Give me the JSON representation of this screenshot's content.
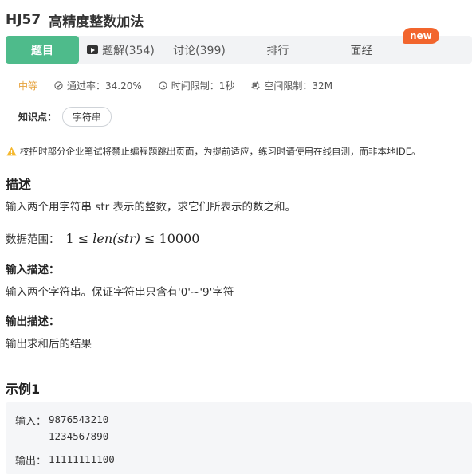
{
  "problem": {
    "id": "HJ57",
    "name": "高精度整数加法"
  },
  "tabs": {
    "question": "题目",
    "solution": "题解(354)",
    "discuss": "讨论(399)",
    "rank": "排行",
    "interview": "面经",
    "new_badge": "new"
  },
  "meta": {
    "difficulty": "中等",
    "pass_rate": "通过率：34.20%",
    "time_limit": "时间限制：1秒",
    "space_limit": "空间限制：32M"
  },
  "knowledge": {
    "label": "知识点：",
    "tags": [
      "字符串"
    ]
  },
  "notice": "校招时部分企业笔试将禁止编程题跳出页面，为提前适应，练习时请使用在线自测，而非本地IDE。",
  "description": {
    "heading": "描述",
    "text": "输入两个用字符串 str 表示的整数，求它们所表示的数之和。",
    "range_label": "数据范围：",
    "range_lhs": "1 ≤ ",
    "range_var": "len(str)",
    "range_rhs": " ≤ 10000"
  },
  "input_desc": {
    "heading": "输入描述：",
    "text": "输入两个字符串。保证字符串只含有'0'~'9'字符"
  },
  "output_desc": {
    "heading": "输出描述：",
    "text": "输出求和后的结果"
  },
  "example": {
    "heading": "示例1",
    "input_label": "输入：",
    "input_lines": [
      "9876543210",
      "1234567890"
    ],
    "output_label": "输出：",
    "output_value": "11111111100"
  },
  "colors": {
    "accent": "#4ebb8b",
    "badge": "#f2652d",
    "difficulty": "#e6a23c"
  }
}
